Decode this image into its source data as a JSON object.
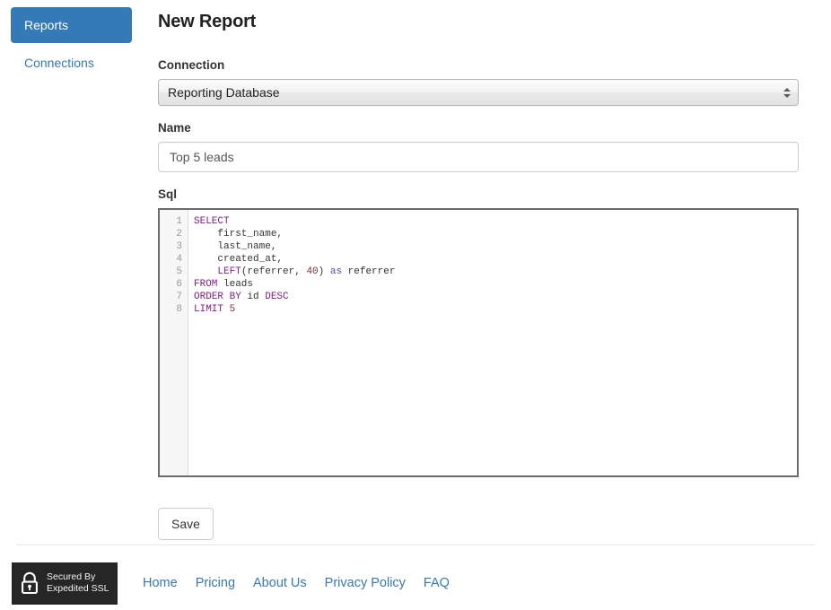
{
  "sidebar": {
    "items": [
      {
        "label": "Reports",
        "active": true
      },
      {
        "label": "Connections",
        "active": false
      }
    ]
  },
  "main": {
    "page_title": "New Report",
    "connection": {
      "label": "Connection",
      "selected": "Reporting Database",
      "options": [
        "Reporting Database"
      ],
      "stepper_icon": "stepper-arrows-icon"
    },
    "name": {
      "label": "Name",
      "value": "Top 5 leads",
      "placeholder": ""
    },
    "sql": {
      "label": "Sql",
      "line_numbers": [
        "1",
        "2",
        "3",
        "4",
        "5",
        "6",
        "7",
        "8"
      ],
      "lines": [
        [
          {
            "t": "SELECT",
            "c": "kw"
          }
        ],
        [
          {
            "t": "    ",
            "c": "punc"
          },
          {
            "t": "first_name,",
            "c": "id"
          }
        ],
        [
          {
            "t": "    ",
            "c": "punc"
          },
          {
            "t": "last_name,",
            "c": "id"
          }
        ],
        [
          {
            "t": "    ",
            "c": "punc"
          },
          {
            "t": "created_at,",
            "c": "id"
          }
        ],
        [
          {
            "t": "    ",
            "c": "punc"
          },
          {
            "t": "LEFT",
            "c": "fn"
          },
          {
            "t": "(referrer, ",
            "c": "id"
          },
          {
            "t": "40",
            "c": "num"
          },
          {
            "t": ") ",
            "c": "punc"
          },
          {
            "t": "as",
            "c": "op"
          },
          {
            "t": " referrer",
            "c": "id"
          }
        ],
        [
          {
            "t": "FROM",
            "c": "kw"
          },
          {
            "t": " leads",
            "c": "id"
          }
        ],
        [
          {
            "t": "ORDER BY",
            "c": "kw"
          },
          {
            "t": " id ",
            "c": "id"
          },
          {
            "t": "DESC",
            "c": "kw"
          }
        ],
        [
          {
            "t": "LIMIT",
            "c": "kw"
          },
          {
            "t": " ",
            "c": "id"
          },
          {
            "t": "5",
            "c": "num"
          }
        ]
      ],
      "plain_text": "SELECT\n    first_name,\n    last_name,\n    created_at,\n    LEFT(referrer, 40) as referrer\nFROM leads\nORDER BY id DESC\nLIMIT 5"
    },
    "save_label": "Save"
  },
  "footer": {
    "ssl_badge": {
      "icon": "padlock-icon",
      "line1": "Secured By",
      "line2": "Expedited SSL"
    },
    "links": [
      {
        "label": "Home"
      },
      {
        "label": "Pricing"
      },
      {
        "label": "About Us"
      },
      {
        "label": "Privacy Policy"
      },
      {
        "label": "FAQ"
      }
    ]
  },
  "colors": {
    "primary": "#337ab7",
    "link": "#3679b5",
    "keyword": "#8b1a8b",
    "number": "#7a3030",
    "operator": "#4a4ab0",
    "editor_border": "#6b6b6b",
    "badge_bg": "#262626"
  }
}
